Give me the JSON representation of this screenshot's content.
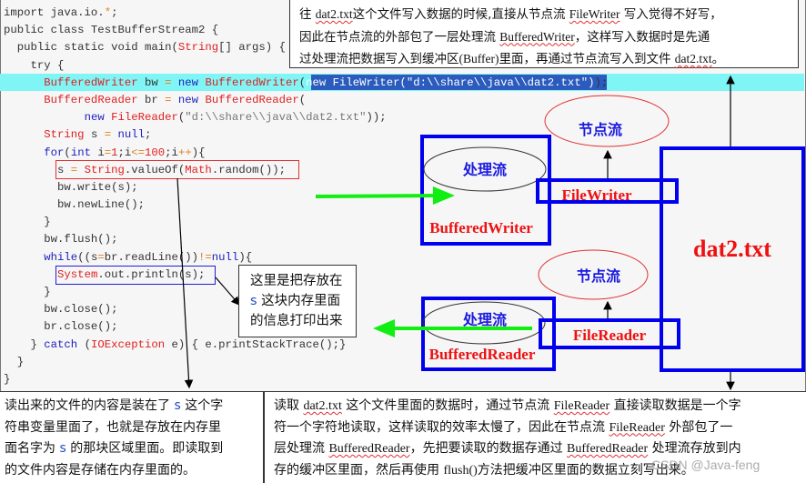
{
  "code": {
    "lines": [
      [
        {
          "t": "import java.io.",
          "c": ""
        },
        {
          "t": "*",
          "c": "op"
        },
        {
          "t": ";",
          "c": ""
        }
      ],
      [
        {
          "t": "public class TestBufferStream2 {",
          "c": ""
        }
      ],
      [
        {
          "t": "  public static void main(",
          "c": ""
        },
        {
          "t": "String",
          "c": "ty"
        },
        {
          "t": "[] args) {",
          "c": ""
        }
      ],
      [
        {
          "t": "    try {",
          "c": ""
        }
      ],
      [
        {
          "t": "      ",
          "c": ""
        },
        {
          "t": "BufferedWriter",
          "c": "ty"
        },
        {
          "t": " bw ",
          "c": ""
        },
        {
          "t": "=",
          "c": "op"
        },
        {
          "t": " ",
          "c": ""
        },
        {
          "t": "new",
          "c": "kw"
        },
        {
          "t": " ",
          "c": ""
        },
        {
          "t": "BufferedWriter",
          "c": "ty"
        },
        {
          "t": "(",
          "c": ""
        },
        {
          "t": "new FileWriter(\"d:\\\\share\\\\java\\\\dat2.txt\")",
          "c": "sel-text"
        },
        {
          "t": ");",
          "c": ""
        }
      ],
      [
        {
          "t": "      ",
          "c": ""
        },
        {
          "t": "BufferedReader",
          "c": "ty"
        },
        {
          "t": " br ",
          "c": ""
        },
        {
          "t": "=",
          "c": "op"
        },
        {
          "t": " ",
          "c": ""
        },
        {
          "t": "new",
          "c": "kw"
        },
        {
          "t": " ",
          "c": ""
        },
        {
          "t": "BufferedReader",
          "c": "ty"
        },
        {
          "t": "(",
          "c": ""
        }
      ],
      [
        {
          "t": "            ",
          "c": ""
        },
        {
          "t": "new",
          "c": "kw"
        },
        {
          "t": " ",
          "c": ""
        },
        {
          "t": "FileReader",
          "c": "ty"
        },
        {
          "t": "(",
          "c": ""
        },
        {
          "t": "\"d:\\\\share\\\\java\\\\dat2.txt\"",
          "c": "st"
        },
        {
          "t": "));",
          "c": ""
        }
      ],
      [
        {
          "t": "      ",
          "c": ""
        },
        {
          "t": "String",
          "c": "ty"
        },
        {
          "t": " s ",
          "c": ""
        },
        {
          "t": "=",
          "c": "op"
        },
        {
          "t": " ",
          "c": ""
        },
        {
          "t": "null",
          "c": "kw"
        },
        {
          "t": ";",
          "c": ""
        }
      ],
      [
        {
          "t": "      ",
          "c": ""
        },
        {
          "t": "for",
          "c": "kw"
        },
        {
          "t": "(",
          "c": ""
        },
        {
          "t": "int",
          "c": "kw"
        },
        {
          "t": " i",
          "c": ""
        },
        {
          "t": "=",
          "c": "op"
        },
        {
          "t": "1",
          "c": "ty"
        },
        {
          "t": ";i",
          "c": ""
        },
        {
          "t": "<=",
          "c": "op"
        },
        {
          "t": "100",
          "c": "ty"
        },
        {
          "t": ";i",
          "c": ""
        },
        {
          "t": "++",
          "c": "op"
        },
        {
          "t": "){",
          "c": ""
        }
      ],
      [
        {
          "t": "        s ",
          "c": ""
        },
        {
          "t": "=",
          "c": "op"
        },
        {
          "t": " ",
          "c": ""
        },
        {
          "t": "String",
          "c": "ty"
        },
        {
          "t": ".valueOf(",
          "c": ""
        },
        {
          "t": "Math",
          "c": "ty"
        },
        {
          "t": ".random());",
          "c": ""
        }
      ],
      [
        {
          "t": "        bw.write(s);",
          "c": ""
        }
      ],
      [
        {
          "t": "        bw.newLine();",
          "c": ""
        }
      ],
      [
        {
          "t": "      }",
          "c": ""
        }
      ],
      [
        {
          "t": "      bw.flush();",
          "c": ""
        }
      ],
      [
        {
          "t": "      ",
          "c": ""
        },
        {
          "t": "while",
          "c": "kw"
        },
        {
          "t": "((s",
          "c": ""
        },
        {
          "t": "=",
          "c": "op"
        },
        {
          "t": "br.readLine())",
          "c": ""
        },
        {
          "t": "!=",
          "c": "op"
        },
        {
          "t": "null",
          "c": "kw"
        },
        {
          "t": "){",
          "c": ""
        }
      ],
      [
        {
          "t": "        ",
          "c": ""
        },
        {
          "t": "System",
          "c": "ty"
        },
        {
          "t": ".out.println(s);",
          "c": ""
        }
      ],
      [
        {
          "t": "      }",
          "c": ""
        }
      ],
      [
        {
          "t": "      bw.close();",
          "c": ""
        }
      ],
      [
        {
          "t": "      br.close();",
          "c": ""
        }
      ],
      [
        {
          "t": "    } ",
          "c": ""
        },
        {
          "t": "catch",
          "c": "kw"
        },
        {
          "t": " (",
          "c": ""
        },
        {
          "t": "IOException",
          "c": "ty"
        },
        {
          "t": " e) { e.printStackTrace();}",
          "c": ""
        }
      ],
      [
        {
          "t": "  }",
          "c": ""
        }
      ],
      [
        {
          "t": "}",
          "c": ""
        }
      ]
    ]
  },
  "notes": {
    "top": [
      [
        {
          "t": "往 "
        },
        {
          "t": "dat2.txt",
          "en": true
        },
        {
          "t": "这个文件写入数据的时候,直接从节点流 "
        },
        {
          "t": "FileWriter",
          "en": true
        },
        {
          "t": " 写入觉得不好写，"
        }
      ],
      [
        {
          "t": "因此在节点流的外部包了一层处理流 "
        },
        {
          "t": "BufferedWriter",
          "en": true
        },
        {
          "t": "，这样写入数据时是先通"
        }
      ],
      [
        {
          "t": "过处理流把数据写入到缓冲区"
        },
        {
          "t": "(Buffer)",
          "plain": true
        },
        {
          "t": "里面，再通过节点流写入到文件 "
        },
        {
          "t": "dat2.txt",
          "en": true
        },
        {
          "t": "。"
        }
      ]
    ],
    "middle": [
      [
        {
          "t": "这里是把存放在"
        }
      ],
      [
        {
          "t": "s",
          "s": true
        },
        {
          "t": " 这块内存里面"
        }
      ],
      [
        {
          "t": "的信息打印出来"
        }
      ]
    ],
    "bottom_left": [
      [
        {
          "t": "读出来的文件的内容是装在了 "
        },
        {
          "t": "s",
          "s": true
        },
        {
          "t": " 这个字"
        }
      ],
      [
        {
          "t": "符串变量里面了，也就是存放在内存里"
        }
      ],
      [
        {
          "t": "面名字为 "
        },
        {
          "t": "s",
          "s": true
        },
        {
          "t": " 的那块区域里面。即读取到"
        }
      ],
      [
        {
          "t": "的文件内容是存储在内存里面的。"
        }
      ]
    ],
    "bottom_right": [
      [
        {
          "t": "读取 "
        },
        {
          "t": "dat2.txt",
          "en": true
        },
        {
          "t": " 这个文件里面的数据时，通过节点流 "
        },
        {
          "t": "FileReader",
          "en": true
        },
        {
          "t": " 直接读取数据是一个字"
        }
      ],
      [
        {
          "t": "符一个字符地读取，这样读取的效率太慢了，因此在节点流 "
        },
        {
          "t": "FileReader",
          "en": true
        },
        {
          "t": " 外部包了一"
        }
      ],
      [
        {
          "t": "层处理流 "
        },
        {
          "t": "BufferedReader",
          "en": true
        },
        {
          "t": "，先把要读取的数据存通过 "
        },
        {
          "t": "BufferedReader",
          "en": true
        },
        {
          "t": " 处理流存放到内"
        }
      ],
      [
        {
          "t": "存的缓冲区里面，然后再使用 "
        },
        {
          "t": "flush()",
          "plain": true
        },
        {
          "t": "方法把缓冲区里面的数据立刻写出来。"
        }
      ]
    ]
  },
  "diagram": {
    "node_stream_label": "节点流",
    "process_stream_label": "处理流",
    "file_writer": "FileWriter",
    "file_reader": "FileReader",
    "buffered_writer": "BufferedWriter",
    "buffered_reader": "BufferedReader",
    "file_name": "dat2.txt",
    "colors": {
      "box_blue": "#0000ee",
      "label_red": "#ee1111",
      "arrow_green": "#11ee11",
      "highlight_cyan": "#7ff5f5",
      "selection_blue": "#2b5bbd"
    }
  },
  "watermark": "CSDN @Java-feng"
}
